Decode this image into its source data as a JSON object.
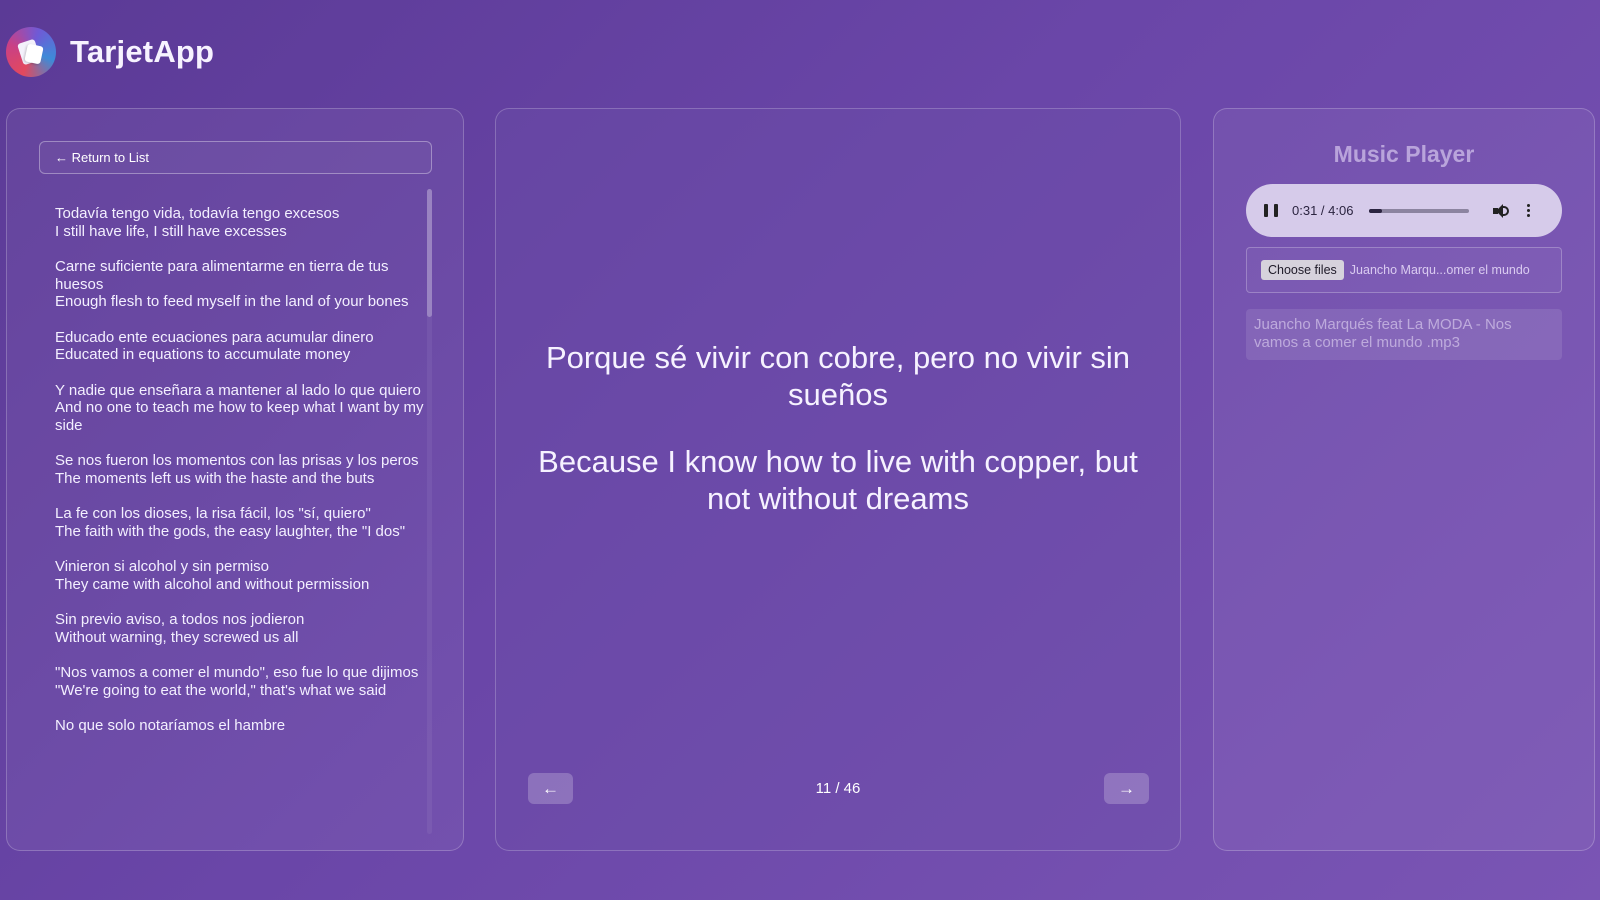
{
  "app": {
    "title": "TarjetApp"
  },
  "left": {
    "return_label": "← Return to List",
    "lyrics": [
      {
        "es": "Todavía tengo vida, todavía tengo excesos",
        "en": "I still have life, I still have excesses"
      },
      {
        "es": "Carne suficiente para alimentarme en tierra de tus huesos",
        "en": "Enough flesh to feed myself in the land of your bones"
      },
      {
        "es": "Educado ente ecuaciones para acumular dinero",
        "en": "Educated in equations to accumulate money"
      },
      {
        "es": "Y nadie que enseñara a mantener al lado lo que quiero",
        "en": "And no one to teach me how to keep what I want by my side"
      },
      {
        "es": "Se nos fueron los momentos con las prisas y los peros",
        "en": "The moments left us with the haste and the buts"
      },
      {
        "es": "La fe con los dioses, la risa fácil, los \"sí, quiero\"",
        "en": "The faith with the gods, the easy laughter, the \"I dos\""
      },
      {
        "es": "Vinieron si alcohol y sin permiso",
        "en": "They came with alcohol and without permission"
      },
      {
        "es": "Sin previo aviso, a todos nos jodieron",
        "en": "Without warning, they screwed us all"
      },
      {
        "es": "\"Nos vamos a comer el mundo\", eso fue lo que dijimos",
        "en": "\"We're going to eat the world,\" that's what we said"
      },
      {
        "es": "No que solo notaríamos el hambre",
        "en": ""
      }
    ]
  },
  "card": {
    "original": "Porque sé vivir con cobre, pero no vivir sin sueños",
    "translation": "Because I know how to live with copper, but not without dreams",
    "counter": "11 / 46",
    "prev_label": "←",
    "next_label": "→"
  },
  "player": {
    "title": "Music Player",
    "time": "0:31 / 4:06",
    "progress_fraction": 0.126,
    "choose_label": "Choose files",
    "file_display": "Juancho Marqu...omer el mundo",
    "playlist": [
      "Juancho Marqués feat La MODA - Nos vamos a comer el mundo .mp3"
    ]
  }
}
